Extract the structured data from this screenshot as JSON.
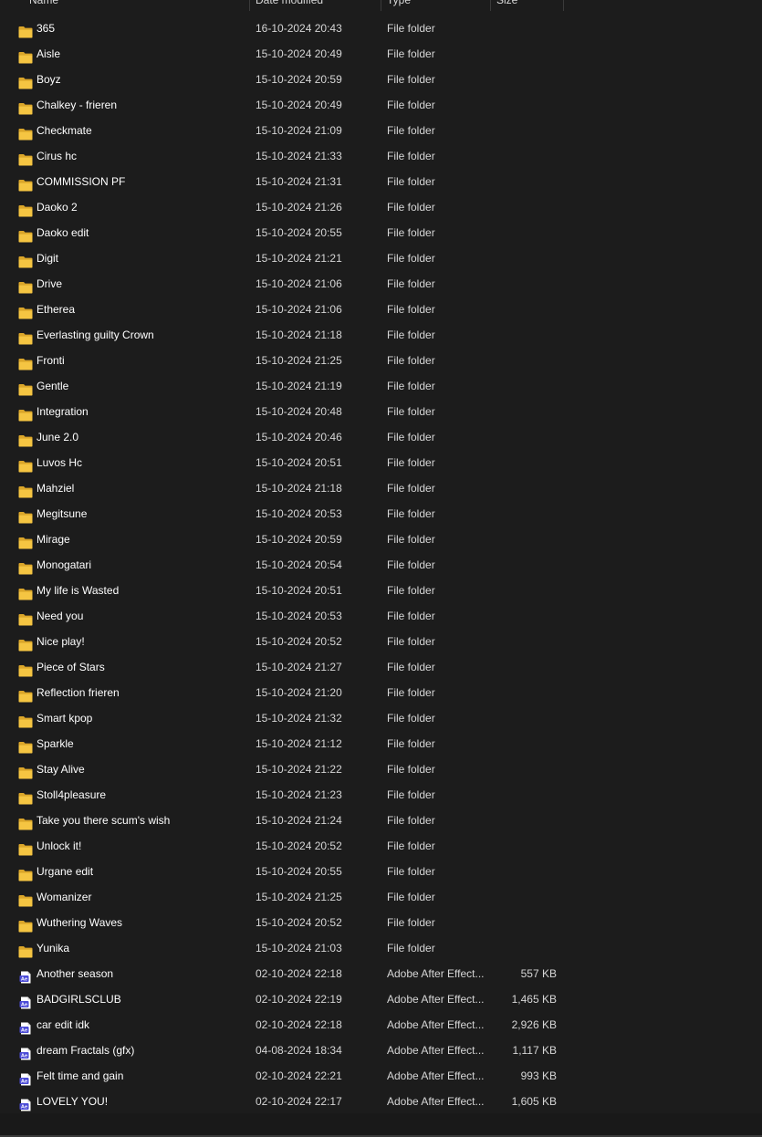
{
  "columns": {
    "name": "Name",
    "date": "Date modified",
    "type": "Type",
    "size": "Size"
  },
  "colors": {
    "folder": "#f5c542",
    "folder_dark": "#dba62a",
    "ae_icon": "#4b4bd6",
    "background": "#1c1c1c"
  },
  "files": [
    {
      "name": "365",
      "date": "16-10-2024 20:43",
      "type": "File folder",
      "size": "",
      "icon": "folder-icon"
    },
    {
      "name": "Aisle",
      "date": "15-10-2024 20:49",
      "type": "File folder",
      "size": "",
      "icon": "folder-icon"
    },
    {
      "name": "Boyz",
      "date": "15-10-2024 20:59",
      "type": "File folder",
      "size": "",
      "icon": "folder-icon"
    },
    {
      "name": "Chalkey - frieren",
      "date": "15-10-2024 20:49",
      "type": "File folder",
      "size": "",
      "icon": "folder-icon"
    },
    {
      "name": "Checkmate",
      "date": "15-10-2024 21:09",
      "type": "File folder",
      "size": "",
      "icon": "folder-icon"
    },
    {
      "name": "Cirus hc",
      "date": "15-10-2024 21:33",
      "type": "File folder",
      "size": "",
      "icon": "folder-icon"
    },
    {
      "name": "COMMISSION PF",
      "date": "15-10-2024 21:31",
      "type": "File folder",
      "size": "",
      "icon": "folder-icon"
    },
    {
      "name": "Daoko 2",
      "date": "15-10-2024 21:26",
      "type": "File folder",
      "size": "",
      "icon": "folder-icon"
    },
    {
      "name": "Daoko edit",
      "date": "15-10-2024 20:55",
      "type": "File folder",
      "size": "",
      "icon": "folder-icon"
    },
    {
      "name": "Digit",
      "date": "15-10-2024 21:21",
      "type": "File folder",
      "size": "",
      "icon": "folder-icon"
    },
    {
      "name": "Drive",
      "date": "15-10-2024 21:06",
      "type": "File folder",
      "size": "",
      "icon": "folder-icon"
    },
    {
      "name": "Etherea",
      "date": "15-10-2024 21:06",
      "type": "File folder",
      "size": "",
      "icon": "folder-icon"
    },
    {
      "name": "Everlasting guilty Crown",
      "date": "15-10-2024 21:18",
      "type": "File folder",
      "size": "",
      "icon": "folder-icon"
    },
    {
      "name": "Fronti",
      "date": "15-10-2024 21:25",
      "type": "File folder",
      "size": "",
      "icon": "folder-icon"
    },
    {
      "name": "Gentle",
      "date": "15-10-2024 21:19",
      "type": "File folder",
      "size": "",
      "icon": "folder-icon"
    },
    {
      "name": "Integration",
      "date": "15-10-2024 20:48",
      "type": "File folder",
      "size": "",
      "icon": "folder-icon"
    },
    {
      "name": "June 2.0",
      "date": "15-10-2024 20:46",
      "type": "File folder",
      "size": "",
      "icon": "folder-icon"
    },
    {
      "name": "Luvos Hc",
      "date": "15-10-2024 20:51",
      "type": "File folder",
      "size": "",
      "icon": "folder-icon"
    },
    {
      "name": "Mahziel",
      "date": "15-10-2024 21:18",
      "type": "File folder",
      "size": "",
      "icon": "folder-icon"
    },
    {
      "name": "Megitsune",
      "date": "15-10-2024 20:53",
      "type": "File folder",
      "size": "",
      "icon": "folder-icon"
    },
    {
      "name": "Mirage",
      "date": "15-10-2024 20:59",
      "type": "File folder",
      "size": "",
      "icon": "folder-icon"
    },
    {
      "name": "Monogatari",
      "date": "15-10-2024 20:54",
      "type": "File folder",
      "size": "",
      "icon": "folder-icon"
    },
    {
      "name": "My life is Wasted",
      "date": "15-10-2024 20:51",
      "type": "File folder",
      "size": "",
      "icon": "folder-icon"
    },
    {
      "name": "Need you",
      "date": "15-10-2024 20:53",
      "type": "File folder",
      "size": "",
      "icon": "folder-icon"
    },
    {
      "name": "Nice play!",
      "date": "15-10-2024 20:52",
      "type": "File folder",
      "size": "",
      "icon": "folder-icon"
    },
    {
      "name": "Piece of Stars",
      "date": "15-10-2024 21:27",
      "type": "File folder",
      "size": "",
      "icon": "folder-icon"
    },
    {
      "name": "Reflection frieren",
      "date": "15-10-2024 21:20",
      "type": "File folder",
      "size": "",
      "icon": "folder-icon"
    },
    {
      "name": "Smart kpop",
      "date": "15-10-2024 21:32",
      "type": "File folder",
      "size": "",
      "icon": "folder-icon"
    },
    {
      "name": "Sparkle",
      "date": "15-10-2024 21:12",
      "type": "File folder",
      "size": "",
      "icon": "folder-icon"
    },
    {
      "name": "Stay Alive",
      "date": "15-10-2024 21:22",
      "type": "File folder",
      "size": "",
      "icon": "folder-icon"
    },
    {
      "name": "Stoll4pleasure",
      "date": "15-10-2024 21:23",
      "type": "File folder",
      "size": "",
      "icon": "folder-icon"
    },
    {
      "name": "Take you there scum's wish",
      "date": "15-10-2024 21:24",
      "type": "File folder",
      "size": "",
      "icon": "folder-icon"
    },
    {
      "name": "Unlock it!",
      "date": "15-10-2024 20:52",
      "type": "File folder",
      "size": "",
      "icon": "folder-icon"
    },
    {
      "name": "Urgane edit",
      "date": "15-10-2024 20:55",
      "type": "File folder",
      "size": "",
      "icon": "folder-icon"
    },
    {
      "name": "Womanizer",
      "date": "15-10-2024 21:25",
      "type": "File folder",
      "size": "",
      "icon": "folder-icon"
    },
    {
      "name": "Wuthering Waves",
      "date": "15-10-2024 20:52",
      "type": "File folder",
      "size": "",
      "icon": "folder-icon"
    },
    {
      "name": "Yunika",
      "date": "15-10-2024 21:03",
      "type": "File folder",
      "size": "",
      "icon": "folder-icon"
    },
    {
      "name": "Another season",
      "date": "02-10-2024 22:18",
      "type": "Adobe After Effect...",
      "size": "557 KB",
      "icon": "after-effects-file-icon"
    },
    {
      "name": "BADGIRLSCLUB",
      "date": "02-10-2024 22:19",
      "type": "Adobe After Effect...",
      "size": "1,465 KB",
      "icon": "after-effects-file-icon"
    },
    {
      "name": "car edit idk",
      "date": "02-10-2024 22:18",
      "type": "Adobe After Effect...",
      "size": "2,926 KB",
      "icon": "after-effects-file-icon"
    },
    {
      "name": "dream Fractals (gfx)",
      "date": "04-08-2024 18:34",
      "type": "Adobe After Effect...",
      "size": "1,117 KB",
      "icon": "after-effects-file-icon"
    },
    {
      "name": "Felt time and gain",
      "date": "02-10-2024 22:21",
      "type": "Adobe After Effect...",
      "size": "993 KB",
      "icon": "after-effects-file-icon"
    },
    {
      "name": "LOVELY YOU!",
      "date": "02-10-2024 22:17",
      "type": "Adobe After Effect...",
      "size": "1,605 KB",
      "icon": "after-effects-file-icon"
    }
  ]
}
